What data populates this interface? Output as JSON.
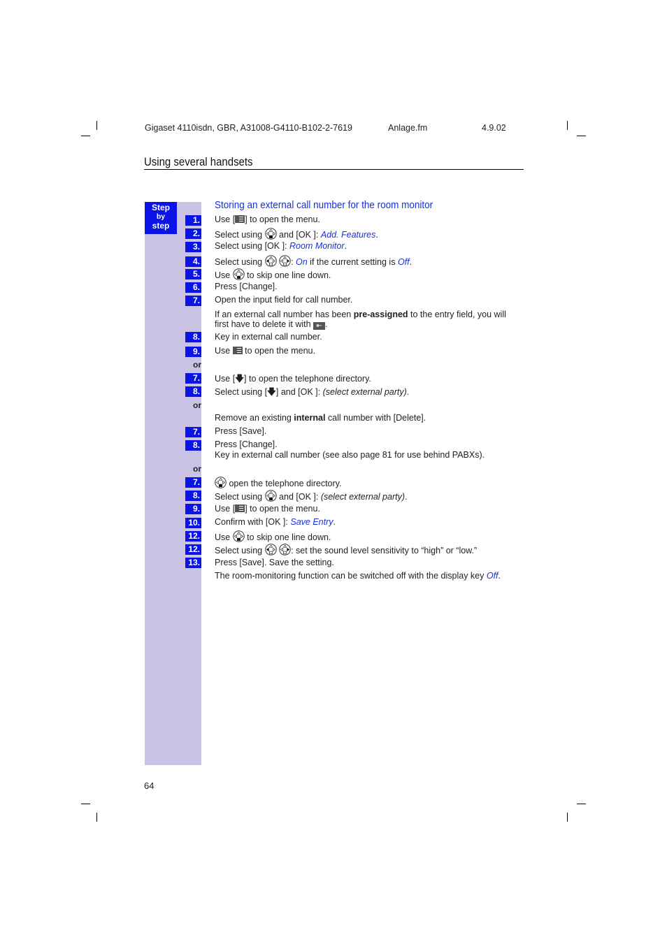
{
  "header": {
    "doc_id": "Gigaset 4110isdn, GBR, A31008-G4110-B102-2-7619",
    "file": "Anlage.fm",
    "date": "4.9.02"
  },
  "section_title": "Using several handsets",
  "sidebar": {
    "step_label_1": "Step",
    "step_label_2": "by",
    "step_label_3": "step"
  },
  "content": {
    "title": "Storing an external call number for the room monitor",
    "steps": [
      {
        "num": "1.",
        "parts": [
          "Use [",
          "] to open the menu."
        ]
      },
      {
        "num": "2.",
        "parts": [
          "Select using ",
          " and [OK ]: ",
          "Add. Features",
          "."
        ]
      },
      {
        "num": "3.",
        "parts": [
          "Select using [OK ]: ",
          "Room Monitor",
          "."
        ]
      },
      {
        "num": "4.",
        "parts": [
          "Select using ",
          ": ",
          "On",
          " if the current setting is ",
          "Off",
          "."
        ]
      },
      {
        "num": "5.",
        "parts": [
          "Use ",
          " to skip one line down."
        ]
      },
      {
        "num": "6.",
        "parts": [
          "Press [Change]."
        ]
      },
      {
        "num": "7.",
        "parts": [
          "Open the input field for call number."
        ]
      },
      {
        "num": "",
        "parts": [
          "If an external call number has been ",
          "pre-assigned",
          " to the entry field, you will first have to delete it with ",
          "."
        ]
      },
      {
        "num": "8.",
        "parts": [
          "Key in external call number."
        ]
      },
      {
        "num": "9.",
        "parts": [
          "Use ",
          " to open the menu."
        ]
      },
      {
        "num": "or",
        "parts": []
      },
      {
        "num": "7.",
        "parts": [
          "Use [",
          "] to open the telephone directory."
        ]
      },
      {
        "num": "8.",
        "parts": [
          "Select using [",
          "] and [OK ]: ",
          "(select external party)",
          "."
        ]
      },
      {
        "num": "or",
        "parts": []
      },
      {
        "num": "",
        "parts": [
          "Remove an existing ",
          "internal",
          " call number with [Delete]."
        ]
      },
      {
        "num": "7.",
        "parts": [
          "Press [Save]."
        ]
      },
      {
        "num": "8.",
        "parts": [
          "Press [Change].",
          "Key in external call number (see also page 81 for use behind PABXs)."
        ]
      },
      {
        "num": "or",
        "parts": []
      },
      {
        "num": "7.",
        "parts": [
          " open the telephone directory."
        ]
      },
      {
        "num": "8.",
        "parts": [
          "Select using ",
          " and [OK ]: ",
          "(select external party)",
          "."
        ]
      },
      {
        "num": "9.",
        "parts": [
          "Use [",
          "] to open the menu."
        ]
      },
      {
        "num": "10.",
        "parts": [
          "Confirm with [OK ]: ",
          "Save Entry",
          "."
        ]
      },
      {
        "num": "12.",
        "parts": [
          "Use ",
          " to skip one line down."
        ]
      },
      {
        "num": "12.",
        "parts": [
          "Select using ",
          ": set the sound level sensitivity to “high” or “low.”"
        ]
      },
      {
        "num": "13.",
        "parts": [
          "Press [Save]. Save the setting."
        ]
      },
      {
        "num": "",
        "parts": [
          "The room-monitoring function can be switched off with the display key ",
          "Off",
          "."
        ]
      }
    ]
  },
  "page_number": "64",
  "colors": {
    "step_blue": "#0a14e6",
    "sidebar_lilac": "#cbc3e5",
    "link_blue": "#1a2fe0"
  }
}
